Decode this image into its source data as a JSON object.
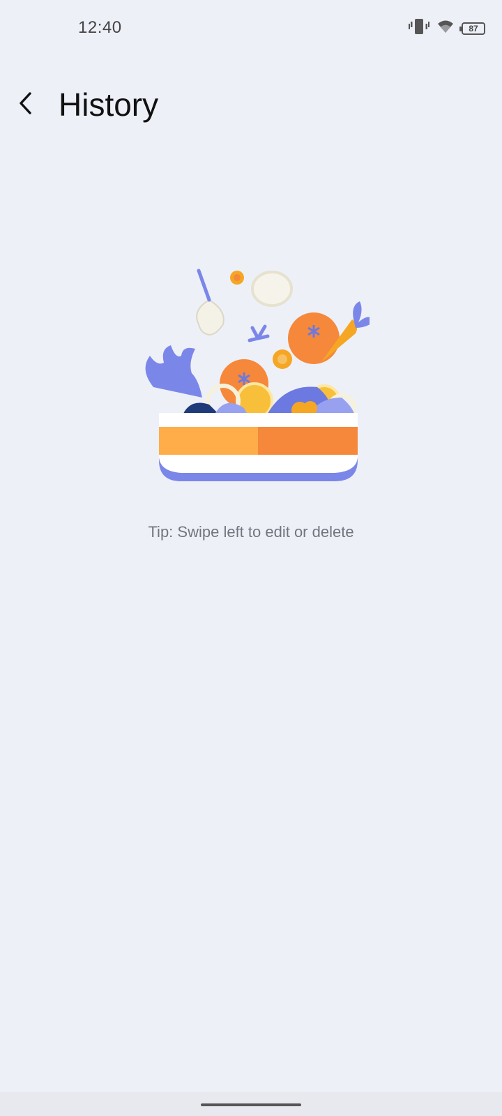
{
  "status_bar": {
    "time": "12:40",
    "battery": "87",
    "icons": [
      "vibrate-icon",
      "wifi-icon",
      "battery-icon"
    ]
  },
  "header": {
    "back_icon": "back-arrow-icon",
    "title": "History"
  },
  "empty_state": {
    "illustration": "salad-bowl-illustration",
    "tip": "Tip: Swipe left to edit or delete"
  },
  "colors": {
    "background": "#eef0f8",
    "title": "#111111",
    "tip": "#72757e",
    "accent_orange": "#f5883a",
    "accent_light_orange": "#ffad48",
    "accent_blue": "#7b87e8"
  }
}
